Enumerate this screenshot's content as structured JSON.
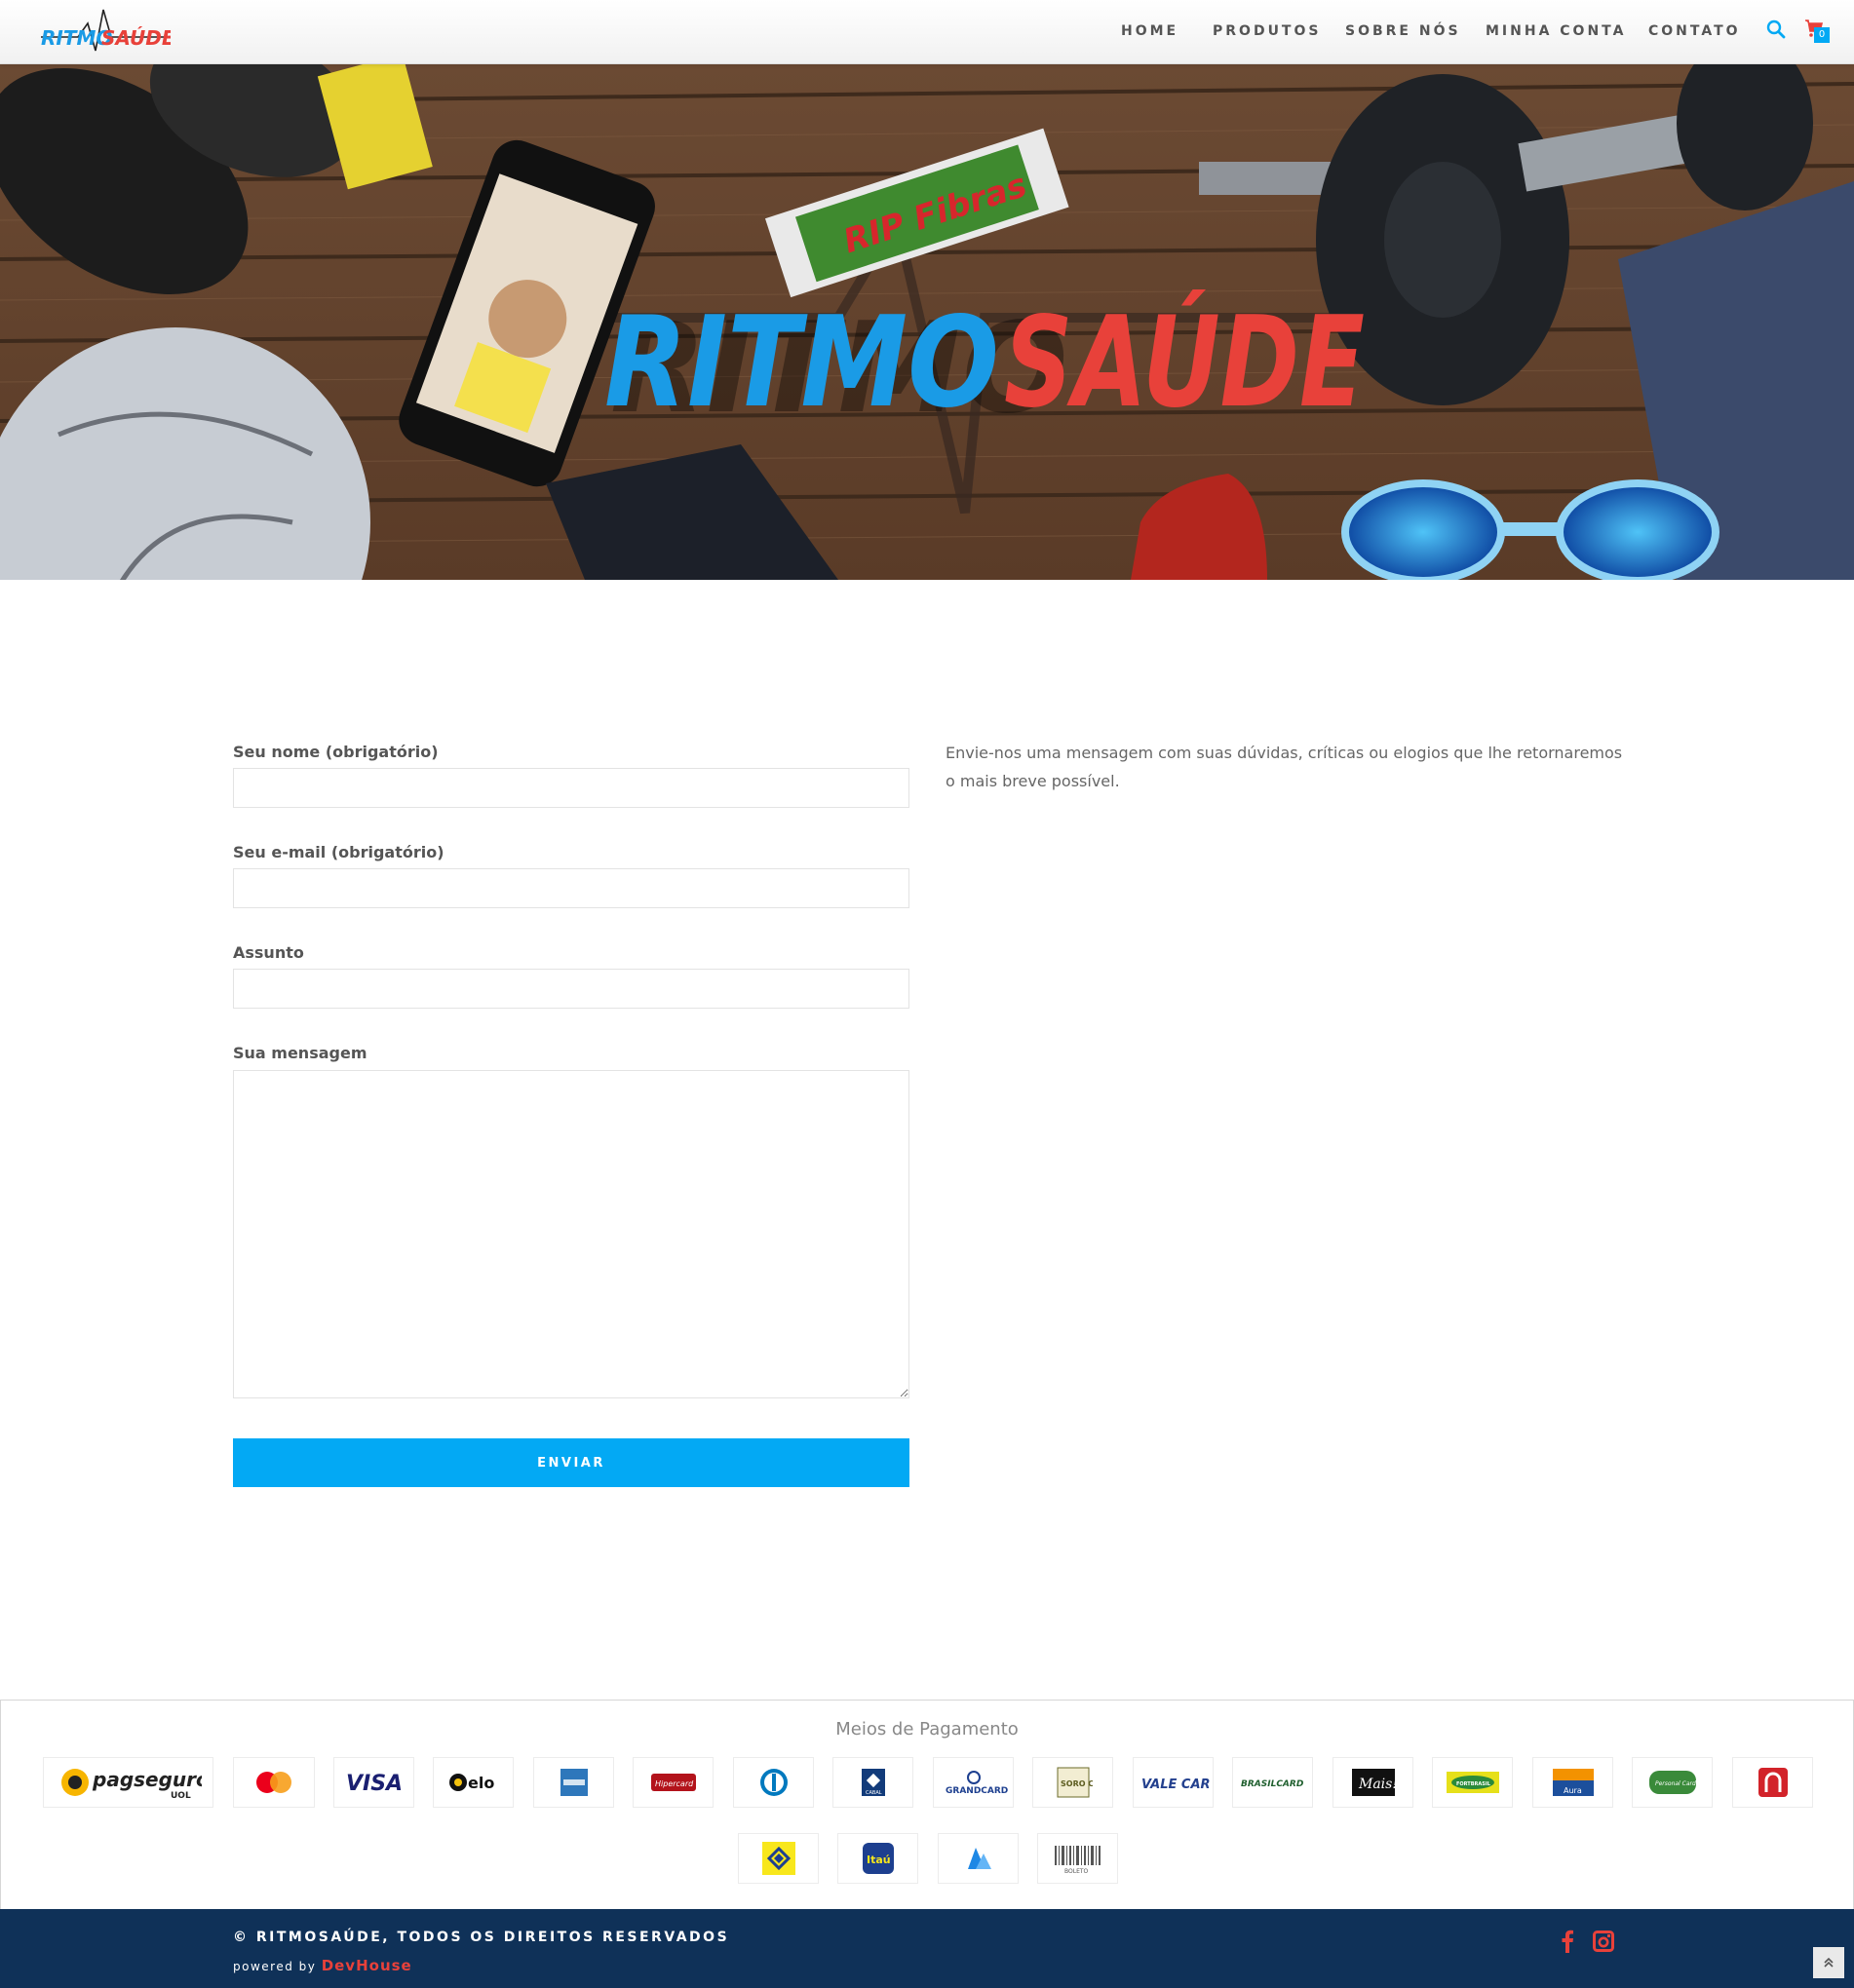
{
  "brand": {
    "logo_part_blue": "RITMO",
    "logo_part_red": "SAÚDE",
    "blue": "#1a9be6",
    "red": "#e8413a",
    "accent": "#03a9f4",
    "footer_bg": "#0f3158"
  },
  "nav": {
    "items": [
      "HOME",
      "PRODUTOS",
      "SOBRE NÓS",
      "MINHA CONTA",
      "CONTATO"
    ],
    "search_icon": "search-icon",
    "cart_icon": "cart-icon",
    "cart_count": "0"
  },
  "banner": {
    "headline_blue": "RITMO",
    "headline_red": "SAÚDE",
    "snack_label": "RIP Fibras"
  },
  "form": {
    "name_label": "Seu nome (obrigatório)",
    "name_value": "",
    "email_label": "Seu e-mail (obrigatório)",
    "email_value": "",
    "subject_label": "Assunto",
    "subject_value": "",
    "message_label": "Sua mensagem",
    "message_value": "",
    "submit_label": "ENVIAR"
  },
  "intro_text": "Envie-nos uma mensagem com suas dúvidas, críticas ou elogios que lhe retornaremos o mais breve possível.",
  "payments": {
    "title": "Meios de Pagamento",
    "methods": [
      {
        "label": "pagseguro",
        "sub": "UOL"
      },
      {
        "label": "mastercard"
      },
      {
        "label": "VISA"
      },
      {
        "label": "elo"
      },
      {
        "label": "AMERICAN EXPRESS"
      },
      {
        "label": "Hipercard"
      },
      {
        "label": "Diners"
      },
      {
        "label": "CABAL"
      },
      {
        "label": "GRANDCARD"
      },
      {
        "label": "SORO CRED"
      },
      {
        "label": "VALE CARD"
      },
      {
        "label": "BRASILCARD"
      },
      {
        "label": "Mais!"
      },
      {
        "label": "FORTBRASIL"
      },
      {
        "label": "Aura"
      },
      {
        "label": "Personal Card"
      },
      {
        "label": "Banrisul"
      },
      {
        "label": "Banco do Brasil"
      },
      {
        "label": "Itaú"
      },
      {
        "label": "Bradesco"
      },
      {
        "label": "BOLETO"
      }
    ]
  },
  "footer": {
    "copyright": "© RITMOSAÚDE, TODOS OS DIREITOS RESERVADOS",
    "powered_by": "powered by",
    "powered_brand": "DevHouse",
    "facebook_icon": "facebook-icon",
    "instagram_icon": "instagram-icon",
    "back_to_top_icon": "chevron-up-icon"
  }
}
